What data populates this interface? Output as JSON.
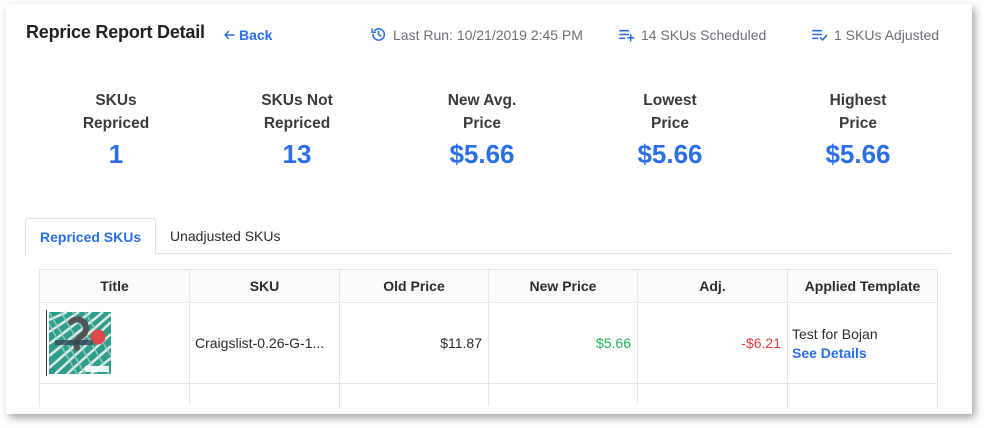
{
  "header": {
    "title": "Reprice Report Detail",
    "back_label": "Back",
    "last_run": "Last Run: 10/21/2019 2:45 PM",
    "scheduled": "14 SKUs Scheduled",
    "adjusted": "1 SKUs Adjusted"
  },
  "stats": [
    {
      "label_line1": "SKUs",
      "label_line2": "Repriced",
      "value": "1"
    },
    {
      "label_line1": "SKUs Not",
      "label_line2": "Repriced",
      "value": "13"
    },
    {
      "label_line1": "New Avg.",
      "label_line2": "Price",
      "value": "$5.66"
    },
    {
      "label_line1": "Lowest",
      "label_line2": "Price",
      "value": "$5.66"
    },
    {
      "label_line1": "Highest",
      "label_line2": "Price",
      "value": "$5.66"
    }
  ],
  "tabs": {
    "repriced": "Repriced SKUs",
    "unadjusted": "Unadjusted SKUs"
  },
  "table": {
    "columns": [
      "Title",
      "SKU",
      "Old Price",
      "New Price",
      "Adj.",
      "Applied Template"
    ],
    "rows": [
      {
        "sku": "Craigslist-0.26-G-1...",
        "old_price": "$11.87",
        "new_price": "$5.66",
        "adj": "-$6.21",
        "template": "Test for Bojan",
        "details_link": "See Details"
      }
    ]
  },
  "colors": {
    "accent": "#2a6ee8",
    "positive": "#22b55a",
    "negative": "#e23a3a"
  }
}
